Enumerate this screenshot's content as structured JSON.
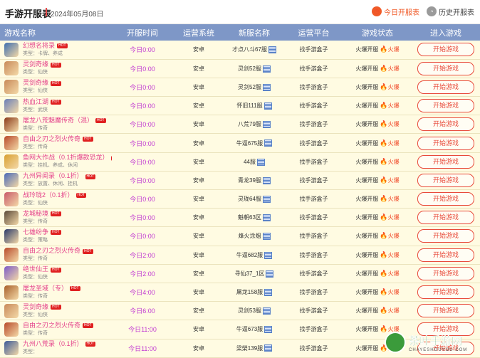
{
  "header": {
    "title": "手游开服表",
    "date": "2024年05月08日",
    "today_label": "今日开服表",
    "history_label": "历史开服表"
  },
  "columns": [
    "游戏名称",
    "开服时间",
    "运营系统",
    "新服名称",
    "运营平台",
    "游戏状态",
    "进入游戏"
  ],
  "play_label": "开始游戏",
  "hot_label": "HOT",
  "rows": [
    {
      "name": "幻想名将录",
      "type": "类型：卡牌、养成",
      "time": "今日0:00",
      "os": "安卓",
      "server": "才点八斗67服",
      "platform": "找手游盒子",
      "status": "火爆开服",
      "heat": "火爆",
      "icon_color": "#3e6fb0"
    },
    {
      "name": "灵剑奇缘",
      "type": "类型：仙侠",
      "time": "今日0:00",
      "os": "安卓",
      "server": "灵剑52服",
      "platform": "找手游盒子",
      "status": "火爆开服",
      "heat": "火爆",
      "icon_color": "#c88a5a"
    },
    {
      "name": "灵剑奇缘",
      "type": "类型：仙侠",
      "time": "今日0:00",
      "os": "安卓",
      "server": "灵剑52服",
      "platform": "找手游盒子",
      "status": "火爆开服",
      "heat": "火爆",
      "icon_color": "#c88a5a"
    },
    {
      "name": "热血江湖",
      "type": "类型：武侠",
      "time": "今日0:00",
      "os": "安卓",
      "server": "怀旧111服",
      "platform": "找手游盒子",
      "status": "火爆开服",
      "heat": "火爆",
      "icon_color": "#6a7fb8"
    },
    {
      "name": "屠龙八荒魅魔传奇（混）",
      "type": "类型：传奇",
      "time": "今日0:00",
      "os": "安卓",
      "server": "八荒79服",
      "platform": "找手游盒子",
      "status": "火爆开服",
      "heat": "火爆",
      "icon_color": "#8a3a1a"
    },
    {
      "name": "自由之刃之烈火传奇",
      "type": "类型：传奇",
      "time": "今日0:00",
      "os": "安卓",
      "server": "牛逼675服",
      "platform": "找手游盒子",
      "status": "火爆开服",
      "heat": "火爆",
      "icon_color": "#b84a2a"
    },
    {
      "name": "鱼网大作战（0.1折爆款恐龙）",
      "type": "类型：挂机、养成、休闲",
      "time": "今日0:00",
      "os": "安卓",
      "server": "44服",
      "platform": "找手游盒子",
      "status": "火爆开服",
      "heat": "火爆",
      "icon_color": "#d8a030"
    },
    {
      "name": "九州异闻录（0.1折）",
      "type": "类型：放置、休闲、挂机",
      "time": "今日0:00",
      "os": "安卓",
      "server": "青龙39服",
      "platform": "找手游盒子",
      "status": "火爆开服",
      "heat": "火爆",
      "icon_color": "#4a6ab8"
    },
    {
      "name": "战玲珑2（0.1折）",
      "type": "类型：仙侠",
      "time": "今日0:00",
      "os": "安卓",
      "server": "灵珑64服",
      "platform": "找手游盒子",
      "status": "火爆开服",
      "heat": "火爆",
      "icon_color": "#c85a6a"
    },
    {
      "name": "龙城秘境",
      "type": "类型：传奇",
      "time": "今日0:00",
      "os": "安卓",
      "server": "魁朝63区",
      "platform": "找手游盒子",
      "status": "火爆开服",
      "heat": "火爆",
      "icon_color": "#5a4a3a"
    },
    {
      "name": "七雄纷争",
      "type": "类型：策略",
      "time": "今日0:00",
      "os": "安卓",
      "server": "烽火涂烟",
      "platform": "找手游盒子",
      "status": "火爆开服",
      "heat": "火爆",
      "icon_color": "#2a3a6a"
    },
    {
      "name": "自由之刃之烈火传奇",
      "type": "类型：传奇",
      "time": "今日2:00",
      "os": "安卓",
      "server": "牛逼682服",
      "platform": "找手游盒子",
      "status": "火爆开服",
      "heat": "火爆",
      "icon_color": "#b84a2a"
    },
    {
      "name": "绝世仙王",
      "type": "类型：仙侠",
      "time": "今日2:00",
      "os": "安卓",
      "server": "寻仙37_1区",
      "platform": "找手游盒子",
      "status": "火爆开服",
      "heat": "火爆",
      "icon_color": "#7a5ac8"
    },
    {
      "name": "屠龙圣域（专）",
      "type": "类型：传奇",
      "time": "今日4:00",
      "os": "安卓",
      "server": "屠龙158服",
      "platform": "找手游盒子",
      "status": "火爆开服",
      "heat": "火爆",
      "icon_color": "#a8602a"
    },
    {
      "name": "灵剑奇缘",
      "type": "类型：仙侠",
      "time": "今日6:00",
      "os": "安卓",
      "server": "灵剑53服",
      "platform": "找手游盒子",
      "status": "火爆开服",
      "heat": "火爆",
      "icon_color": "#c88a5a"
    },
    {
      "name": "自由之刃之烈火传奇",
      "type": "类型：传奇",
      "time": "今日11:00",
      "os": "安卓",
      "server": "牛逼673服",
      "platform": "找手游盒子",
      "status": "火爆开服",
      "heat": "火爆",
      "icon_color": "#b84a2a"
    },
    {
      "name": "九州八荒录（0.1折）",
      "type": "类型：",
      "time": "今日11:00",
      "os": "安卓",
      "server": "梁榮139服",
      "platform": "找手游盒子",
      "status": "火爆开服",
      "heat": "火爆",
      "icon_color": "#3a5a9a"
    }
  ],
  "watermark": {
    "main": "茶叶手游网",
    "sub": "CHAYESHOUYOU.COM"
  }
}
